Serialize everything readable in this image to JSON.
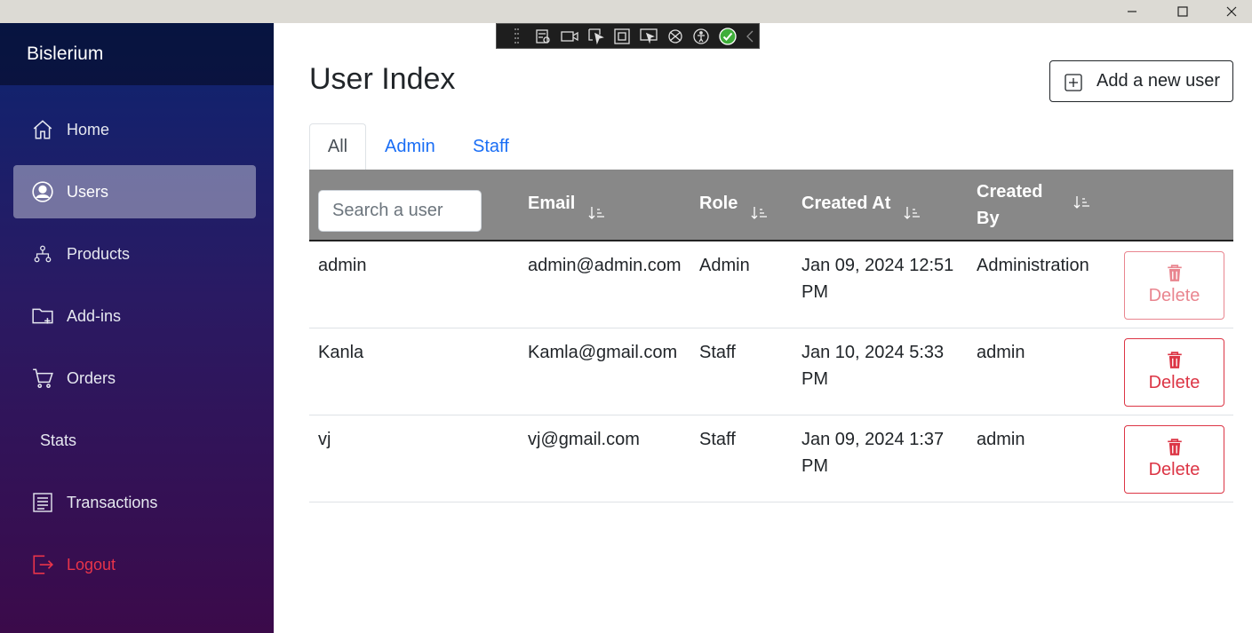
{
  "window": {
    "minimize": "minimize-icon",
    "maximize": "maximize-icon",
    "close": "close-icon"
  },
  "sidebar": {
    "brand": "Bislerium",
    "items": [
      {
        "label": "Home",
        "icon": "home-icon"
      },
      {
        "label": "Users",
        "icon": "user-circle-icon",
        "active": true
      },
      {
        "label": "Products",
        "icon": "hierarchy-icon"
      },
      {
        "label": "Add-ins",
        "icon": "folder-plus-icon"
      },
      {
        "label": "Orders",
        "icon": "cart-icon"
      },
      {
        "label": "Stats",
        "icon": ""
      },
      {
        "label": "Transactions",
        "icon": "receipt-icon"
      },
      {
        "label": "Logout",
        "icon": "logout-icon"
      }
    ]
  },
  "main": {
    "title": "User Index",
    "add_button": "Add a new user",
    "tabs": [
      {
        "label": "All",
        "active": true
      },
      {
        "label": "Admin"
      },
      {
        "label": "Staff"
      }
    ],
    "search": {
      "placeholder": "Search a user",
      "value": ""
    },
    "columns": [
      {
        "label": "Email"
      },
      {
        "label": "Role"
      },
      {
        "label": "Created At"
      },
      {
        "label": "Created By"
      }
    ],
    "rows": [
      {
        "name": "admin",
        "email": "admin@admin.com",
        "role": "Admin",
        "created_at": "Jan 09, 2024 12:51 PM",
        "created_by": "Administration",
        "delete": "Delete",
        "delete_disabled": true
      },
      {
        "name": "Kanla",
        "email": "Kamla@gmail.com",
        "role": "Staff",
        "created_at": "Jan 10, 2024 5:33 PM",
        "created_by": "admin",
        "delete": "Delete",
        "delete_disabled": false
      },
      {
        "name": "vj",
        "email": "vj@gmail.com",
        "role": "Staff",
        "created_at": "Jan 09, 2024 1:37 PM",
        "created_by": "admin",
        "delete": "Delete",
        "delete_disabled": false
      }
    ]
  },
  "colors": {
    "accent": "#1a6ef5",
    "danger": "#dc3545",
    "header_bg": "#888888",
    "logout": "#e8344a"
  }
}
